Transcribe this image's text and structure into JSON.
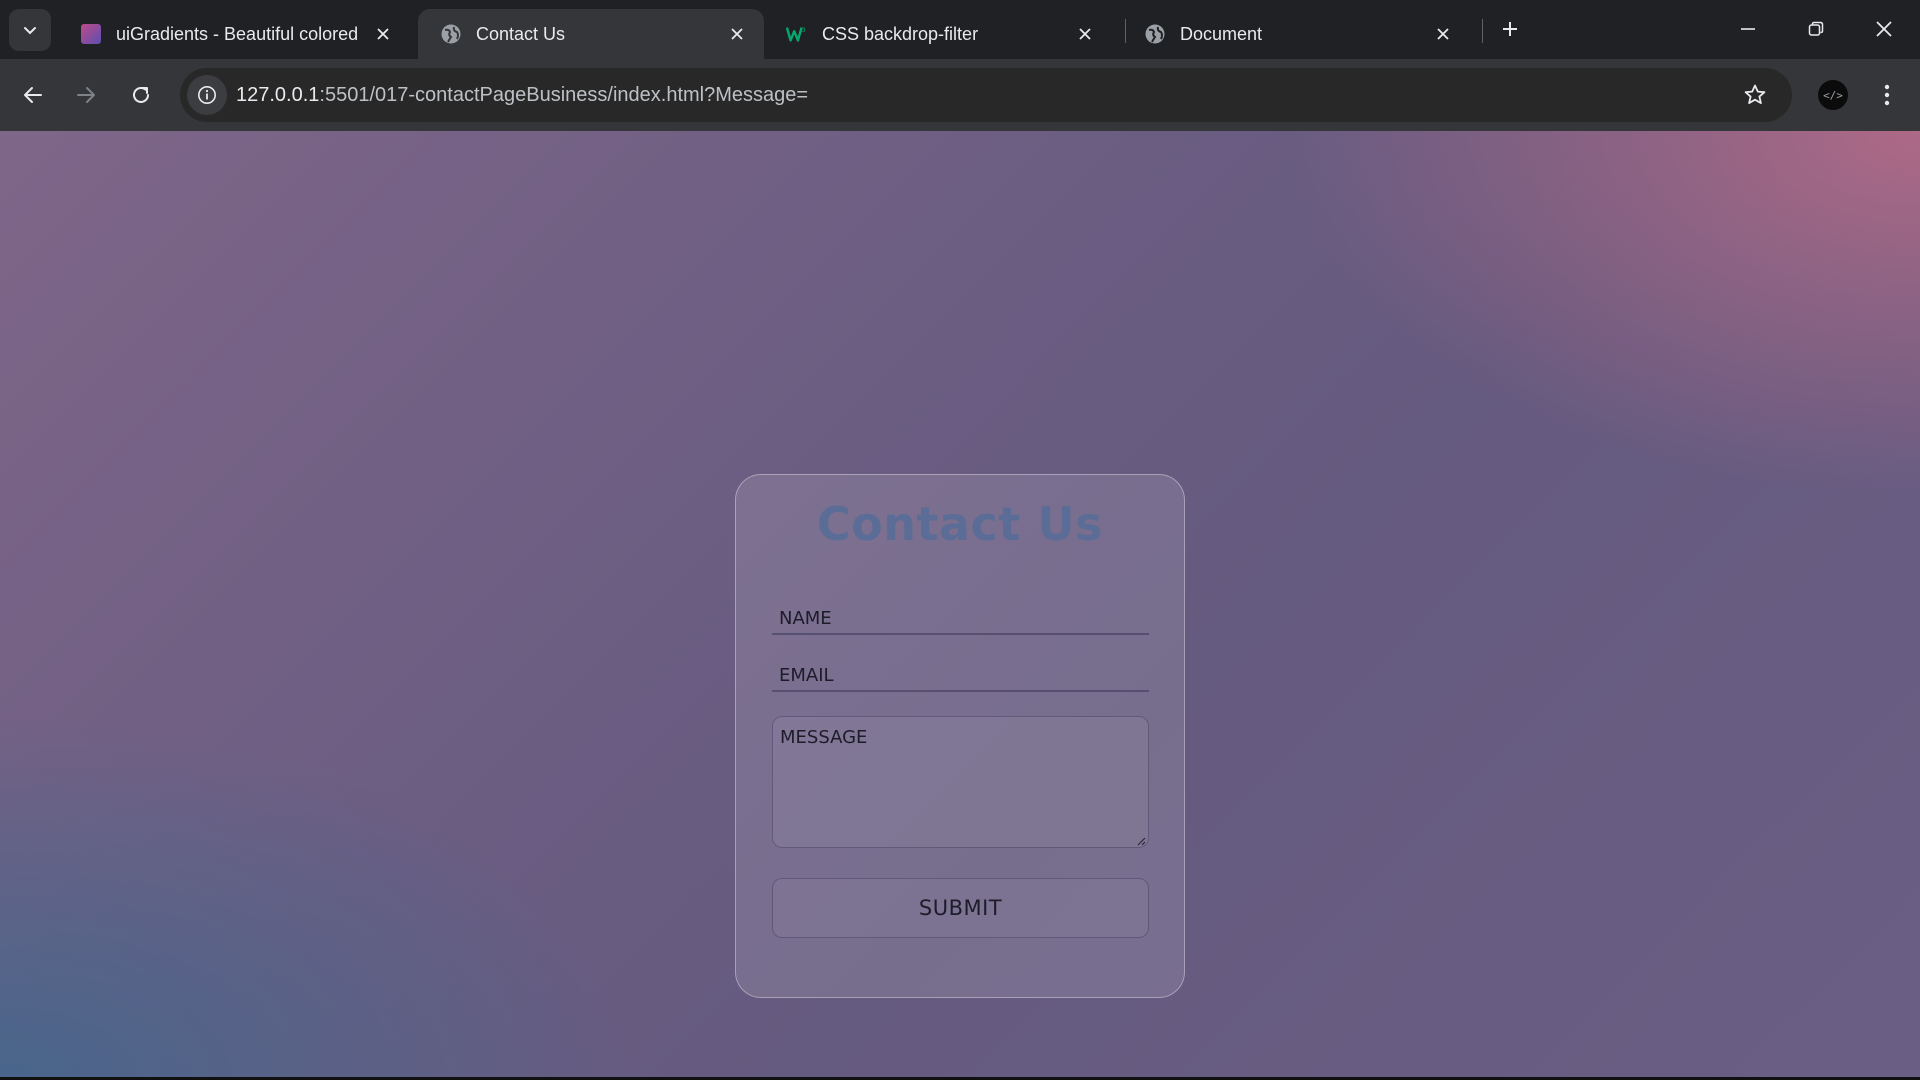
{
  "browser": {
    "tabs": [
      {
        "title": "uiGradients - Beautiful colored",
        "favicon": "uigradients-favicon",
        "active": false
      },
      {
        "title": "Contact Us",
        "favicon": "globe-icon",
        "active": true
      },
      {
        "title": "CSS backdrop-filter",
        "favicon": "w3schools-favicon",
        "active": false
      },
      {
        "title": "Document",
        "favicon": "globe-icon",
        "active": false
      }
    ],
    "address_bar": {
      "host": "127.0.0.1",
      "rest": ":5501/017-contactPageBusiness/index.html?Message="
    },
    "extension_label": "</>"
  },
  "page": {
    "title": "Contact Us",
    "name_placeholder": "NAME",
    "email_placeholder": "EMAIL",
    "message_placeholder": "MESSAGE",
    "submit_label": "SUBMIT"
  },
  "colors": {
    "title": "#5b6d96",
    "gradient_top_right": "#ba6c88",
    "gradient_bottom_left": "#47668c"
  }
}
